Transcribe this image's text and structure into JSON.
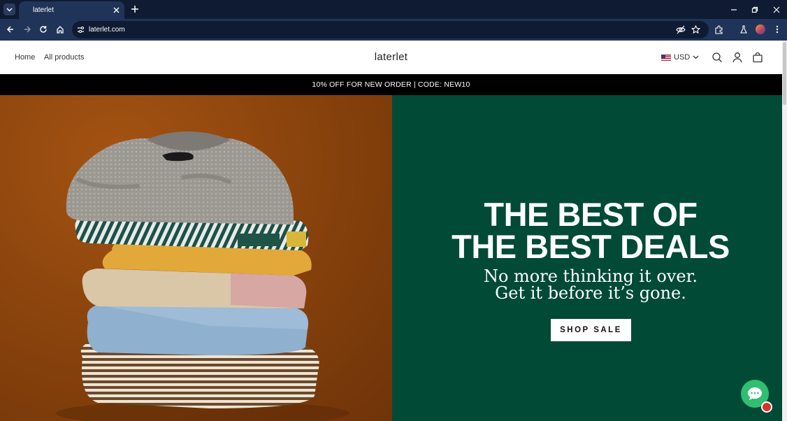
{
  "browser": {
    "tab_title": "laterlet",
    "url": "laterlet.com"
  },
  "site": {
    "nav": [
      "Home",
      "All products"
    ],
    "brand": "laterlet",
    "currency": "USD"
  },
  "announcement": "10% OFF FOR NEW ORDER | CODE: NEW10",
  "hero": {
    "headline_line1": "THE BEST OF",
    "headline_line2": "THE BEST DEALS",
    "sub_line1": "No more thinking it over.",
    "sub_line2": "Get it before it’s gone.",
    "cta": "SHOP SALE"
  },
  "colors": {
    "tab_bar": "#0f1b33",
    "toolbar": "#203459",
    "hero_green": "#004a36",
    "chat_green": "#2fbf71"
  },
  "icons": [
    "tab-dropdown-icon",
    "close-icon",
    "plus-icon",
    "minimize-icon",
    "restore-icon",
    "window-close-icon",
    "back-icon",
    "forward-icon",
    "reload-icon",
    "home-icon",
    "site-settings-icon",
    "eye-off-icon",
    "star-icon",
    "extensions-icon",
    "labs-icon",
    "profile-avatar",
    "menu-dots-icon",
    "search-icon",
    "account-icon",
    "cart-icon",
    "chat-icon"
  ]
}
